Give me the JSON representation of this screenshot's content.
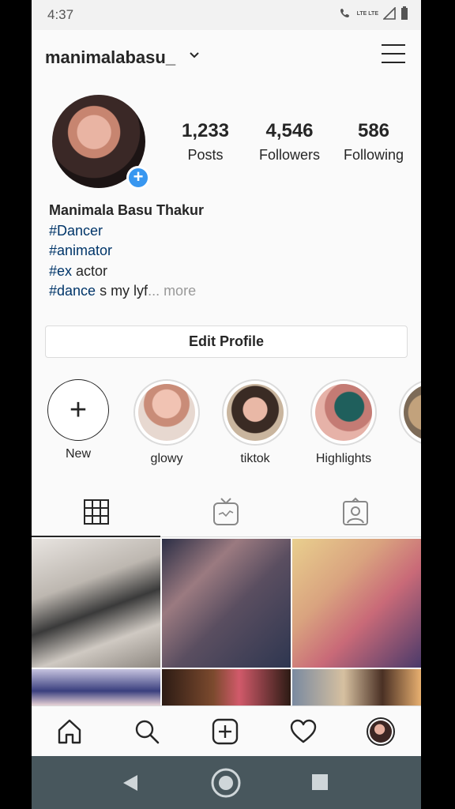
{
  "status": {
    "time": "4:37",
    "network": "LTE LTE"
  },
  "header": {
    "username": "manimalabasu_"
  },
  "profile": {
    "posts_count": "1,233",
    "posts_label": "Posts",
    "followers_count": "4,546",
    "followers_label": "Followers",
    "following_count": "586",
    "following_label": "Following"
  },
  "bio": {
    "name": "Manimala Basu Thakur",
    "line1_tag": "#Dancer",
    "line2_tag": "#animator",
    "line3_tag": "#ex",
    "line3_text": " actor",
    "line4_tag": "#dance",
    "line4_text": " s my lyf",
    "line4_more": "... more"
  },
  "edit_profile_label": "Edit Profile",
  "highlights": [
    {
      "label": "New"
    },
    {
      "label": "glowy"
    },
    {
      "label": "tiktok"
    },
    {
      "label": "Highlights"
    }
  ],
  "tabs": [
    "grid-icon",
    "igtv-icon",
    "tagged-icon"
  ],
  "nav": [
    "home-icon",
    "search-icon",
    "add-post-icon",
    "heart-icon",
    "profile-avatar"
  ],
  "colors": {
    "accent": "#3897f0",
    "hashtag": "#003569",
    "sysnav": "#48575d"
  }
}
